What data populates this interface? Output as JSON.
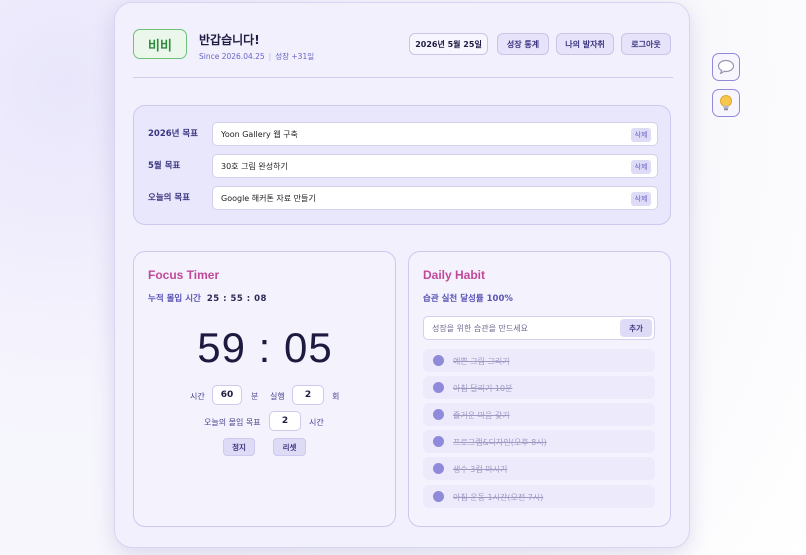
{
  "header": {
    "avatar_name": "비비",
    "greeting": "반갑습니다!",
    "since": "Since 2026.04.25",
    "growth": "성장 +31일",
    "date": "2026년 5월 25일",
    "buttons": [
      "성장 통계",
      "나의 발자취",
      "로그아웃"
    ]
  },
  "goals": [
    {
      "label": "2026년 목표",
      "value": "Yoon Gallery 웹 구축",
      "delete": "삭제"
    },
    {
      "label": "5월 목표",
      "value": "30호 그림 완성하기",
      "delete": "삭제"
    },
    {
      "label": "오늘의 목표",
      "value": "Google 해커톤 자료 만들기",
      "delete": "삭제"
    }
  ],
  "timer": {
    "title": "Focus Timer",
    "total_label": "누적 몰입 시간",
    "total_value": "25 : 55 : 08",
    "display": "59 : 05",
    "time_label": "시간",
    "minutes": "60",
    "minutes_unit": "분",
    "run_label": "실행",
    "runs": "2",
    "runs_unit": "회",
    "daily_goal_label": "오늘의 몰입 목표",
    "daily_goal": "2",
    "daily_goal_unit": "시간",
    "stop": "정지",
    "reset": "리셋"
  },
  "habit": {
    "title": "Daily Habit",
    "rate_label": "습관 실천 달성률 100%",
    "placeholder": "성장을 위한 습관을 만드세요",
    "add": "추가",
    "items": [
      "예쁜 그림 그리기",
      "아침 달리기 10분",
      "즐거운 마음 갖기",
      "프로그램&디자인(오후 8시)",
      "생수 3컵 마시기",
      "아침 운동 1시간(오전 7시)"
    ],
    "dot_color": "#8f8ad9"
  },
  "side": {
    "icons": [
      "speech-bubble-icon",
      "lightbulb-icon"
    ]
  },
  "colors": {
    "accent": "#6a64c8",
    "title_pink": "#c2489a",
    "avatar_green": "#2e8a3c"
  }
}
